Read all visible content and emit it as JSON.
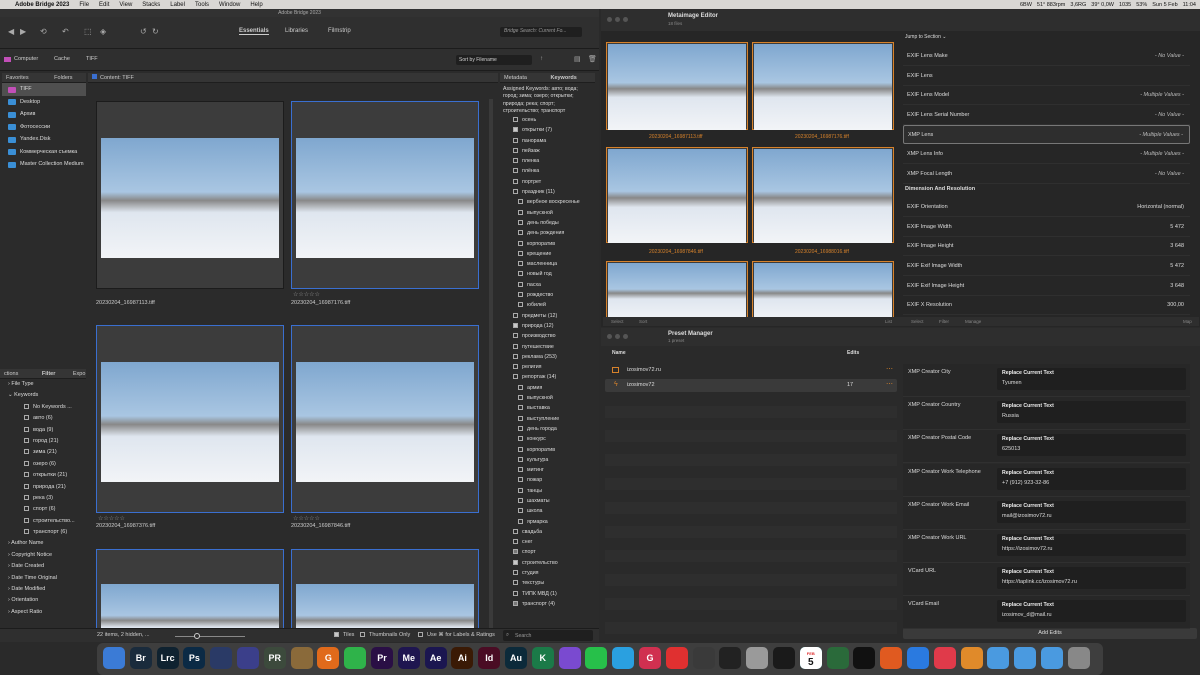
{
  "menubar": {
    "app": "Adobe Bridge 2023",
    "items": [
      "File",
      "Edit",
      "View",
      "Stacks",
      "Label",
      "Tools",
      "Window",
      "Help"
    ],
    "status": [
      "6BW",
      "51° 883rpm",
      "3,6RG",
      "39° 0,0W",
      "1035",
      "53%",
      "Sun 5 Feb",
      "11:04"
    ]
  },
  "bridge": {
    "window_title": "Adobe Bridge 2023",
    "workspaces": [
      "Essentials",
      "Libraries",
      "Filmstrip"
    ],
    "search_placeholder": "Bridge Search: Current Fo...",
    "breadcrumb": [
      "Computer",
      "Cache",
      "TIFF"
    ],
    "sort_label": "Sort by Filename",
    "tabs": {
      "favorites": "Favorites",
      "folders": "Folders",
      "content": "Content: TIFF",
      "metadata": "Metadata",
      "keywords": "Keywords",
      "filter": "Filter",
      "collections": "ctions",
      "export": "Expo"
    },
    "favorites": [
      "TIFF",
      "Desktop",
      "Архив",
      "Фотосессии",
      "Yandex.Disk",
      "Коммерческая съемка",
      "Master Collection Medium"
    ],
    "filters": {
      "file_type": "File Type",
      "keywords_hdr": "Keywords",
      "keyword_items": [
        "No Keywords ...",
        "авто (6)",
        "вода (9)",
        "город (21)",
        "зима (21)",
        "озеро (6)",
        "открытки (21)",
        "природа (21)",
        "река (3)",
        "спорт (6)",
        "строительство...",
        "транспорт (6)"
      ],
      "others": [
        "Author Name",
        "Copyright Notice",
        "Date Created",
        "Date Time Original",
        "Date Modified",
        "Orientation",
        "Aspect Ratio"
      ]
    },
    "thumbs": [
      {
        "name": "20230204_16987113.tiff",
        "stars": ""
      },
      {
        "name": "20230204_16987176.tiff",
        "stars": "☆☆☆☆☆"
      },
      {
        "name": "20230204_16987376.tiff",
        "stars": "☆☆☆☆☆"
      },
      {
        "name": "20230204_16987846.tiff",
        "stars": "☆☆☆☆☆"
      }
    ],
    "thumb_names_bottom": [
      "20230204_16987113.tiff",
      "20230204_16987176.tiff",
      "20230204_16987376.tiff",
      "20230204_16987846.tiff"
    ],
    "status_bar": {
      "items": "22 items, 2 hidden, ...",
      "tiles": "Tiles",
      "thumbs_only": "Thumbnails Only",
      "use_labels": "Use ⌘ for Labels & Ratings",
      "search": "Search"
    },
    "assigned_keywords": "Assigned Keywords: авто; вода; город; зима; озеро; открытки; природа; река; спорт; строительство; транспорт",
    "keywords": [
      {
        "t": "осень",
        "c": 0,
        "i": 0
      },
      {
        "t": "открытки (7)",
        "c": 1,
        "i": 0
      },
      {
        "t": "панорама",
        "c": 0,
        "i": 0
      },
      {
        "t": "пейзаж",
        "c": 0,
        "i": 0
      },
      {
        "t": "пленка",
        "c": 0,
        "i": 0
      },
      {
        "t": "плёнка",
        "c": 0,
        "i": 0
      },
      {
        "t": "портрет",
        "c": 0,
        "i": 0
      },
      {
        "t": "праздник (11)",
        "c": 0,
        "i": 0
      },
      {
        "t": "вербное воскресенье",
        "c": 0,
        "i": 1
      },
      {
        "t": "выпускной",
        "c": 0,
        "i": 1
      },
      {
        "t": "день победы",
        "c": 0,
        "i": 1
      },
      {
        "t": "день рождения",
        "c": 0,
        "i": 1
      },
      {
        "t": "корпоратив",
        "c": 0,
        "i": 1
      },
      {
        "t": "крещение",
        "c": 0,
        "i": 1
      },
      {
        "t": "масленница",
        "c": 0,
        "i": 1
      },
      {
        "t": "новый год",
        "c": 0,
        "i": 1
      },
      {
        "t": "пасха",
        "c": 0,
        "i": 1
      },
      {
        "t": "рождество",
        "c": 0,
        "i": 1
      },
      {
        "t": "юбилей",
        "c": 0,
        "i": 1
      },
      {
        "t": "предметы (12)",
        "c": 0,
        "i": 0
      },
      {
        "t": "природа (12)",
        "c": 1,
        "i": 0
      },
      {
        "t": "производство",
        "c": 0,
        "i": 0
      },
      {
        "t": "путешествие",
        "c": 0,
        "i": 0
      },
      {
        "t": "реклама (253)",
        "c": 0,
        "i": 0
      },
      {
        "t": "религия",
        "c": 0,
        "i": 0
      },
      {
        "t": "репортаж (14)",
        "c": 0,
        "i": 0
      },
      {
        "t": "армия",
        "c": 0,
        "i": 1
      },
      {
        "t": "выпускной",
        "c": 0,
        "i": 1
      },
      {
        "t": "выставка",
        "c": 0,
        "i": 1
      },
      {
        "t": "выступление",
        "c": 0,
        "i": 1
      },
      {
        "t": "день города",
        "c": 0,
        "i": 1
      },
      {
        "t": "конкурс",
        "c": 0,
        "i": 1
      },
      {
        "t": "корпоратив",
        "c": 0,
        "i": 1
      },
      {
        "t": "культура",
        "c": 0,
        "i": 1
      },
      {
        "t": "митинг",
        "c": 0,
        "i": 1
      },
      {
        "t": "пожар",
        "c": 0,
        "i": 1
      },
      {
        "t": "танцы",
        "c": 0,
        "i": 1
      },
      {
        "t": "шахматы",
        "c": 0,
        "i": 1
      },
      {
        "t": "школа",
        "c": 0,
        "i": 1
      },
      {
        "t": "ярмарка",
        "c": 0,
        "i": 1
      },
      {
        "t": "свадьба",
        "c": 0,
        "i": 0
      },
      {
        "t": "снег",
        "c": 0,
        "i": 0
      },
      {
        "t": "спорт",
        "c": 2,
        "i": 0
      },
      {
        "t": "строительство",
        "c": 1,
        "i": 0
      },
      {
        "t": "студия",
        "c": 0,
        "i": 0
      },
      {
        "t": "текстуры",
        "c": 0,
        "i": 0
      },
      {
        "t": "ТИПК МВД (1)",
        "c": 0,
        "i": 0
      },
      {
        "t": "транспорт (4)",
        "c": 2,
        "i": 0
      }
    ]
  },
  "metaimage": {
    "title": "Metaimage Editor",
    "subtitle": "18 files",
    "files": [
      "20230204_16987113.tiff",
      "20230204_16987176.tiff",
      "20230204_16987846.tiff",
      "20230204_16988016.tiff"
    ],
    "bottom": [
      "Select",
      "Sort",
      "List",
      "Select",
      "Filter",
      "Manage",
      "Map"
    ],
    "jump": "Jump to Section ⌄",
    "fields": [
      {
        "k": "EXIF Lens Make",
        "v": "- No Value -",
        "i": 1
      },
      {
        "k": "EXIF Lens",
        "v": "",
        "i": 1
      },
      {
        "k": "EXIF Lens Model",
        "v": "- Multiple Values -",
        "i": 1
      },
      {
        "k": "EXIF Lens Serial Number",
        "v": "- No Value -",
        "i": 1
      },
      {
        "k": "XMP Lens",
        "v": "- Multiple Values -",
        "i": 1
      },
      {
        "k": "XMP Lens Info",
        "v": "- Multiple Values -",
        "i": 1
      },
      {
        "k": "XMP Focal Length",
        "v": "- No Value -",
        "i": 1
      }
    ],
    "section": "Dimension And Resolution",
    "dims": [
      {
        "k": "EXIF Orientation",
        "v": "Horizontal (normal)"
      },
      {
        "k": "EXIF Image Width",
        "v": "5 472"
      },
      {
        "k": "EXIF Image Height",
        "v": "3 648"
      },
      {
        "k": "EXIF Exif Image Width",
        "v": "5 472"
      },
      {
        "k": "EXIF Exif Image Height",
        "v": "3 648"
      },
      {
        "k": "EXIF X Resolution",
        "v": "300,00"
      }
    ]
  },
  "preset": {
    "title": "Preset Manager",
    "subtitle": "1 preset",
    "col_name": "Name",
    "col_edits": "Edits",
    "rows": [
      {
        "name": "izosimov72.ru",
        "edits": ""
      },
      {
        "name": "izosimov72",
        "edits": "17"
      }
    ],
    "replace": "Replace Current Text",
    "fields": [
      {
        "k": "XMP Creator City",
        "v": "Tyumen"
      },
      {
        "k": "XMP Creator Country",
        "v": "Russia"
      },
      {
        "k": "XMP Creator Postal Code",
        "v": "625013"
      },
      {
        "k": "XMP Creator Work Telephone",
        "v": "+7 (912) 923-32-86"
      },
      {
        "k": "XMP Creator Work Email",
        "v": "mail@izosimov72.ru"
      },
      {
        "k": "XMP Creator Work URL",
        "v": "https://izosimov72.ru"
      },
      {
        "k": "VCard URL",
        "v": "https://taplink.cc/izosimov72.ru"
      },
      {
        "k": "VCard Email",
        "v": "izosimov_d@mail.ru"
      }
    ],
    "add_edits": "Add Edits"
  },
  "dock": {
    "calendar_month": "FEB",
    "calendar_day": "5",
    "apps": [
      {
        "label": "",
        "color": "#3b7bd6"
      },
      {
        "label": "Br",
        "color": "#1a2b3c"
      },
      {
        "label": "Lrc",
        "color": "#0f2230"
      },
      {
        "label": "Ps",
        "color": "#0b2a45"
      },
      {
        "label": "",
        "color": "#2a3a66"
      },
      {
        "label": "",
        "color": "#3b3f8a"
      },
      {
        "label": "PR",
        "color": "#3c4a3c"
      },
      {
        "label": "",
        "color": "#8a6a3a"
      },
      {
        "label": "G",
        "color": "#e06a1b"
      },
      {
        "label": "",
        "color": "#2fb34a"
      },
      {
        "label": "Pr",
        "color": "#2a0f45"
      },
      {
        "label": "Me",
        "color": "#1f1650"
      },
      {
        "label": "Ae",
        "color": "#1b1650"
      },
      {
        "label": "Ai",
        "color": "#3a1a05"
      },
      {
        "label": "Id",
        "color": "#4a0c24"
      },
      {
        "label": "Au",
        "color": "#0c2a3a"
      },
      {
        "label": "K",
        "color": "#1b7a48"
      },
      {
        "label": "",
        "color": "#7a4ad0"
      },
      {
        "label": "",
        "color": "#27c04a"
      },
      {
        "label": "",
        "color": "#2aa0e0"
      },
      {
        "label": "G",
        "color": "#d03050"
      },
      {
        "label": "",
        "color": "#e03030"
      },
      {
        "label": "",
        "color": "#3a3a3a"
      },
      {
        "label": "",
        "color": "#222"
      },
      {
        "label": "",
        "color": "#9a9a9a"
      },
      {
        "label": "",
        "color": "#1a1a1a"
      },
      {
        "label": "",
        "color": "#2ad0e0"
      },
      {
        "label": "",
        "color": "#2a6a3a"
      },
      {
        "label": "",
        "color": "#111"
      },
      {
        "label": "",
        "color": "#e05a20"
      },
      {
        "label": "",
        "color": "#2a7ae0"
      },
      {
        "label": "",
        "color": "#e03a4a"
      },
      {
        "label": "",
        "color": "#e08a2a"
      },
      {
        "label": "",
        "color": "#4a9ae0"
      },
      {
        "label": "",
        "color": "#4a9ae0"
      },
      {
        "label": "",
        "color": "#4a9ae0"
      },
      {
        "label": "",
        "color": "#888"
      }
    ]
  }
}
